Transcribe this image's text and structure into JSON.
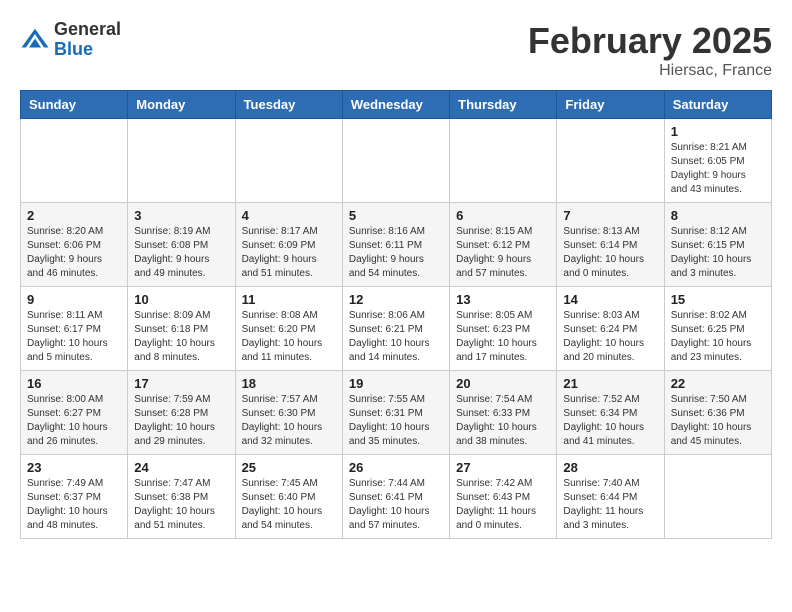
{
  "header": {
    "logo_general": "General",
    "logo_blue": "Blue",
    "main_title": "February 2025",
    "subtitle": "Hiersac, France"
  },
  "calendar": {
    "days_of_week": [
      "Sunday",
      "Monday",
      "Tuesday",
      "Wednesday",
      "Thursday",
      "Friday",
      "Saturday"
    ],
    "weeks": [
      [
        {
          "day": "",
          "info": ""
        },
        {
          "day": "",
          "info": ""
        },
        {
          "day": "",
          "info": ""
        },
        {
          "day": "",
          "info": ""
        },
        {
          "day": "",
          "info": ""
        },
        {
          "day": "",
          "info": ""
        },
        {
          "day": "1",
          "info": "Sunrise: 8:21 AM\nSunset: 6:05 PM\nDaylight: 9 hours and 43 minutes."
        }
      ],
      [
        {
          "day": "2",
          "info": "Sunrise: 8:20 AM\nSunset: 6:06 PM\nDaylight: 9 hours and 46 minutes."
        },
        {
          "day": "3",
          "info": "Sunrise: 8:19 AM\nSunset: 6:08 PM\nDaylight: 9 hours and 49 minutes."
        },
        {
          "day": "4",
          "info": "Sunrise: 8:17 AM\nSunset: 6:09 PM\nDaylight: 9 hours and 51 minutes."
        },
        {
          "day": "5",
          "info": "Sunrise: 8:16 AM\nSunset: 6:11 PM\nDaylight: 9 hours and 54 minutes."
        },
        {
          "day": "6",
          "info": "Sunrise: 8:15 AM\nSunset: 6:12 PM\nDaylight: 9 hours and 57 minutes."
        },
        {
          "day": "7",
          "info": "Sunrise: 8:13 AM\nSunset: 6:14 PM\nDaylight: 10 hours and 0 minutes."
        },
        {
          "day": "8",
          "info": "Sunrise: 8:12 AM\nSunset: 6:15 PM\nDaylight: 10 hours and 3 minutes."
        }
      ],
      [
        {
          "day": "9",
          "info": "Sunrise: 8:11 AM\nSunset: 6:17 PM\nDaylight: 10 hours and 5 minutes."
        },
        {
          "day": "10",
          "info": "Sunrise: 8:09 AM\nSunset: 6:18 PM\nDaylight: 10 hours and 8 minutes."
        },
        {
          "day": "11",
          "info": "Sunrise: 8:08 AM\nSunset: 6:20 PM\nDaylight: 10 hours and 11 minutes."
        },
        {
          "day": "12",
          "info": "Sunrise: 8:06 AM\nSunset: 6:21 PM\nDaylight: 10 hours and 14 minutes."
        },
        {
          "day": "13",
          "info": "Sunrise: 8:05 AM\nSunset: 6:23 PM\nDaylight: 10 hours and 17 minutes."
        },
        {
          "day": "14",
          "info": "Sunrise: 8:03 AM\nSunset: 6:24 PM\nDaylight: 10 hours and 20 minutes."
        },
        {
          "day": "15",
          "info": "Sunrise: 8:02 AM\nSunset: 6:25 PM\nDaylight: 10 hours and 23 minutes."
        }
      ],
      [
        {
          "day": "16",
          "info": "Sunrise: 8:00 AM\nSunset: 6:27 PM\nDaylight: 10 hours and 26 minutes."
        },
        {
          "day": "17",
          "info": "Sunrise: 7:59 AM\nSunset: 6:28 PM\nDaylight: 10 hours and 29 minutes."
        },
        {
          "day": "18",
          "info": "Sunrise: 7:57 AM\nSunset: 6:30 PM\nDaylight: 10 hours and 32 minutes."
        },
        {
          "day": "19",
          "info": "Sunrise: 7:55 AM\nSunset: 6:31 PM\nDaylight: 10 hours and 35 minutes."
        },
        {
          "day": "20",
          "info": "Sunrise: 7:54 AM\nSunset: 6:33 PM\nDaylight: 10 hours and 38 minutes."
        },
        {
          "day": "21",
          "info": "Sunrise: 7:52 AM\nSunset: 6:34 PM\nDaylight: 10 hours and 41 minutes."
        },
        {
          "day": "22",
          "info": "Sunrise: 7:50 AM\nSunset: 6:36 PM\nDaylight: 10 hours and 45 minutes."
        }
      ],
      [
        {
          "day": "23",
          "info": "Sunrise: 7:49 AM\nSunset: 6:37 PM\nDaylight: 10 hours and 48 minutes."
        },
        {
          "day": "24",
          "info": "Sunrise: 7:47 AM\nSunset: 6:38 PM\nDaylight: 10 hours and 51 minutes."
        },
        {
          "day": "25",
          "info": "Sunrise: 7:45 AM\nSunset: 6:40 PM\nDaylight: 10 hours and 54 minutes."
        },
        {
          "day": "26",
          "info": "Sunrise: 7:44 AM\nSunset: 6:41 PM\nDaylight: 10 hours and 57 minutes."
        },
        {
          "day": "27",
          "info": "Sunrise: 7:42 AM\nSunset: 6:43 PM\nDaylight: 11 hours and 0 minutes."
        },
        {
          "day": "28",
          "info": "Sunrise: 7:40 AM\nSunset: 6:44 PM\nDaylight: 11 hours and 3 minutes."
        },
        {
          "day": "",
          "info": ""
        }
      ]
    ]
  }
}
